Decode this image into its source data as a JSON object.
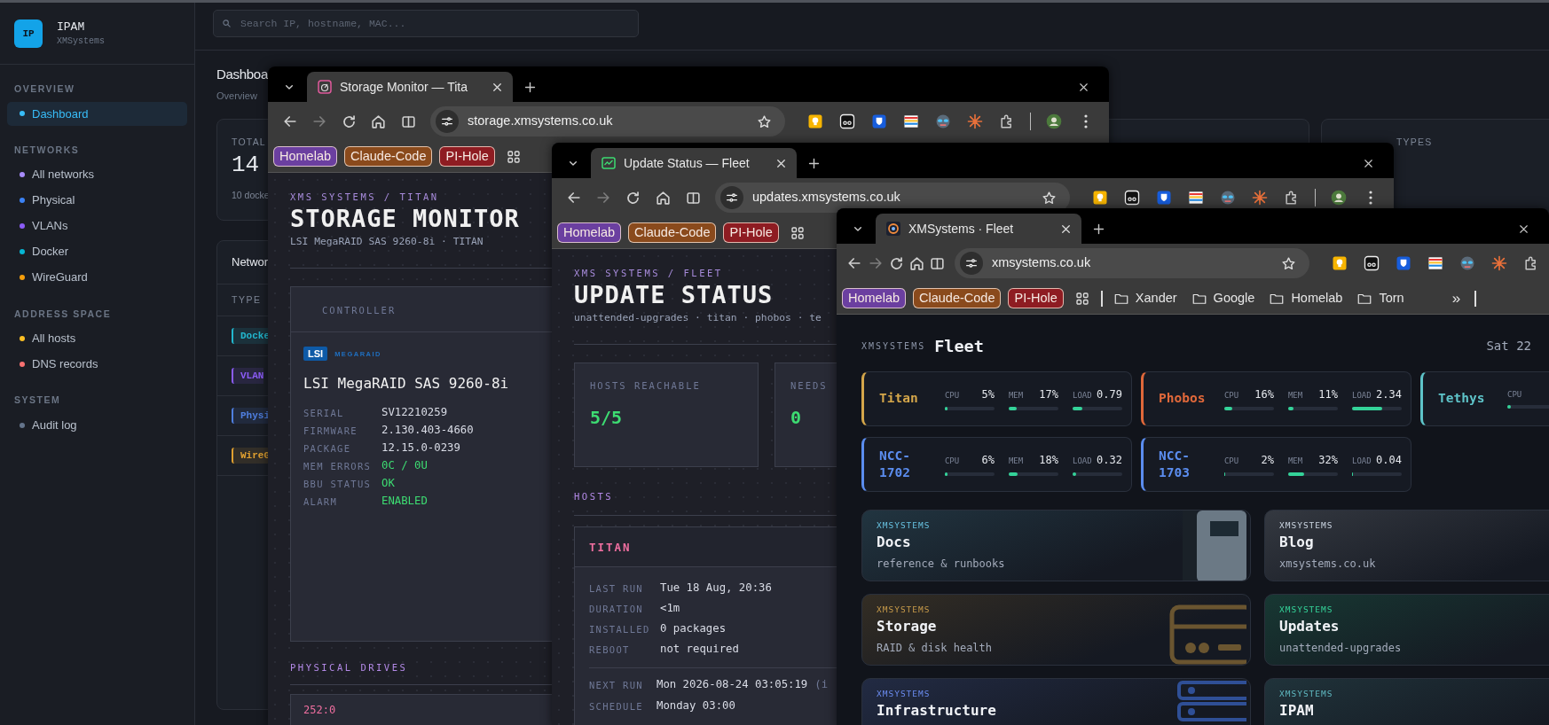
{
  "ipam": {
    "brand": {
      "logo": "IP",
      "name": "IPAM",
      "org": "XMSystems"
    },
    "search": {
      "placeholder": "Search IP, hostname, MAC..."
    },
    "sidebar": [
      {
        "heading": "OVERVIEW",
        "items": [
          {
            "label": "Dashboard",
            "color": "#38bdf8",
            "selected": true
          }
        ]
      },
      {
        "heading": "NETWORKS",
        "items": [
          {
            "label": "All networks",
            "color": "#a78bfa",
            "selected": false
          },
          {
            "label": "Physical",
            "color": "#3b82f6",
            "selected": false
          },
          {
            "label": "VLANs",
            "color": "#8b5cf6",
            "selected": false
          },
          {
            "label": "Docker",
            "color": "#06b6d4",
            "selected": false
          },
          {
            "label": "WireGuard",
            "color": "#f59e0b",
            "selected": false
          }
        ]
      },
      {
        "heading": "ADDRESS SPACE",
        "items": [
          {
            "label": "All hosts",
            "color": "#fbbf24",
            "selected": false
          },
          {
            "label": "DNS records",
            "color": "#f87171",
            "selected": false
          }
        ]
      },
      {
        "heading": "SYSTEM",
        "items": [
          {
            "label": "Audit log",
            "color": "#64748b",
            "selected": false
          }
        ]
      }
    ],
    "page": {
      "title": "Dashboa",
      "subtitle": "Overview"
    },
    "stat_cards": [
      {
        "label": "TOTAL",
        "value": "14",
        "note": "10 docke"
      },
      {
        "label": "TYPES"
      }
    ],
    "networks_card": {
      "title": "Networ",
      "column_1": "TYPE",
      "badges": [
        {
          "label": "Docke",
          "color": "#22b8cf"
        },
        {
          "label": "VLAN",
          "color": "#8b5cf6"
        },
        {
          "label": "Physi",
          "color": "#4f7fe0"
        },
        {
          "label": "WireG",
          "color": "#e0a030"
        }
      ]
    }
  },
  "windows": [
    {
      "kind": "storage",
      "tab_title": "Storage Monitor — Tita",
      "url": "storage.xmsystems.co.uk",
      "bookmarks": [
        {
          "kind": "chip",
          "label": "Homelab",
          "color": "#6b3fa0"
        },
        {
          "kind": "chip",
          "label": "Claude-Code",
          "color": "#8a4a1c"
        },
        {
          "kind": "chip",
          "label": "PI-Hole",
          "color": "#8e1c22"
        },
        {
          "kind": "apps"
        }
      ],
      "content": {
        "breadcrumb": "XMS SYSTEMS / TITAN",
        "title": "STORAGE MONITOR",
        "subtitle": "LSI MegaRAID SAS 9260-8i · TITAN",
        "controller": {
          "heading": "CONTROLLER",
          "logo_mark": "LSI",
          "logo_text": "MEGARAID",
          "model": "LSI MegaRAID SAS 9260-8i",
          "fields": [
            {
              "label": "SERIAL",
              "value": "SV12210259",
              "kind": "plain"
            },
            {
              "label": "FIRMWARE",
              "value": "2.130.403-4660",
              "kind": "plain"
            },
            {
              "label": "PACKAGE",
              "value": "12.15.0-0239",
              "kind": "plain"
            },
            {
              "label": "MEM ERRORS",
              "value": "0C / 0U",
              "kind": "ok"
            },
            {
              "label": "BBU STATUS",
              "value": "OK",
              "kind": "ok"
            },
            {
              "label": "ALARM",
              "value": "ENABLED",
              "kind": "ok"
            }
          ]
        },
        "drives_heading": "PHYSICAL DRIVES",
        "drives": [
          {
            "id": "252:0"
          }
        ]
      }
    },
    {
      "kind": "updates",
      "tab_title": "Update Status — Fleet",
      "url": "updates.xmsystems.co.uk",
      "bookmarks": [
        {
          "kind": "chip",
          "label": "Homelab",
          "color": "#6b3fa0"
        },
        {
          "kind": "chip",
          "label": "Claude-Code",
          "color": "#8a4a1c"
        },
        {
          "kind": "chip",
          "label": "PI-Hole",
          "color": "#8e1c22"
        },
        {
          "kind": "apps"
        }
      ],
      "content": {
        "breadcrumb": "XMS SYSTEMS / FLEET",
        "title": "UPDATE STATUS",
        "subtitle": "unattended-upgrades · titan · phobos · te",
        "stats": [
          {
            "label": "HOSTS REACHABLE",
            "value": "5/5"
          },
          {
            "label": "NEEDS",
            "value": "0"
          }
        ],
        "hosts_heading": "HOSTS",
        "host": {
          "name": "TITAN",
          "fields": [
            {
              "label": "LAST RUN",
              "value": "Tue 18 Aug, 20:36"
            },
            {
              "label": "DURATION",
              "value": "<1m"
            },
            {
              "label": "INSTALLED",
              "value": "0 packages"
            },
            {
              "label": "REBOOT",
              "value": "not required"
            }
          ],
          "schedule": [
            {
              "label": "NEXT RUN",
              "value": "Mon 2026-08-24 03:05:19",
              "note": "(i"
            },
            {
              "label": "SCHEDULE",
              "value": "Monday 03:00"
            }
          ]
        }
      }
    },
    {
      "kind": "fleet",
      "tab_title": "XMSystems · Fleet",
      "url": "xmsystems.co.uk",
      "bookmarks": [
        {
          "kind": "chip",
          "label": "Homelab",
          "color": "#6b3fa0"
        },
        {
          "kind": "chip",
          "label": "Claude-Code",
          "color": "#8a4a1c"
        },
        {
          "kind": "chip",
          "label": "PI-Hole",
          "color": "#8e1c22"
        },
        {
          "kind": "apps"
        },
        {
          "kind": "separator"
        },
        {
          "kind": "folder",
          "label": "Xander"
        },
        {
          "kind": "folder",
          "label": "Google"
        },
        {
          "kind": "folder",
          "label": "Homelab"
        },
        {
          "kind": "folder",
          "label": "Torn"
        },
        {
          "kind": "overflow",
          "label": "»"
        },
        {
          "kind": "separator"
        }
      ],
      "content": {
        "brand": "XMSYSTEMS",
        "title": "Fleet",
        "date": "Sat 22",
        "hosts": [
          {
            "name": "Titan",
            "color": "#d4a64a",
            "metrics": [
              {
                "label": "CPU",
                "value": "5%",
                "level": 0.05
              },
              {
                "label": "MEM",
                "value": "17%",
                "level": 0.17
              },
              {
                "label": "LOAD",
                "value": "0.79",
                "level": 0.2
              }
            ]
          },
          {
            "name": "Phobos",
            "color": "#e0683a",
            "metrics": [
              {
                "label": "CPU",
                "value": "16%",
                "level": 0.16
              },
              {
                "label": "MEM",
                "value": "11%",
                "level": 0.11
              },
              {
                "label": "LOAD",
                "value": "2.34",
                "level": 0.6
              }
            ]
          },
          {
            "name": "Tethys",
            "color": "#5ec4c9",
            "metrics": [
              {
                "label": "CPU",
                "level": 0.06
              }
            ]
          },
          {
            "name": "NCC-1702",
            "color": "#5b8def",
            "metrics": [
              {
                "label": "CPU",
                "value": "6%",
                "level": 0.06
              },
              {
                "label": "MEM",
                "value": "18%",
                "level": 0.18
              },
              {
                "label": "LOAD",
                "value": "0.32",
                "level": 0.08
              }
            ]
          },
          {
            "name": "NCC-1703",
            "color": "#5b8def",
            "metrics": [
              {
                "label": "CPU",
                "value": "2%",
                "level": 0.02
              },
              {
                "label": "MEM",
                "value": "32%",
                "level": 0.32
              },
              {
                "label": "LOAD",
                "value": "0.04",
                "level": 0.01
              }
            ]
          }
        ],
        "links": [
          {
            "kicker": "XMSYSTEMS",
            "title": "Docs",
            "subtitle": "reference & runbooks",
            "color": "#67c1e0",
            "kind": "book"
          },
          {
            "kicker": "XMSYSTEMS",
            "title": "Blog",
            "subtitle": "xmsystems.co.uk",
            "color": "#cbd5e1",
            "kind": "plain"
          },
          {
            "kicker": "XMSYSTEMS",
            "title": "Storage",
            "subtitle": "RAID & disk health",
            "color": "#c79a4a",
            "kind": "drive"
          },
          {
            "kicker": "XMSYSTEMS",
            "title": "Updates",
            "subtitle": "unattended-upgrades",
            "color": "#34d399",
            "kind": "plain"
          },
          {
            "kicker": "XMSYSTEMS",
            "title": "Infrastructure",
            "color": "#6b8cf0",
            "kind": "server"
          },
          {
            "kicker": "XMSYSTEMS",
            "title": "IPAM",
            "color": "#5fb8c0",
            "kind": "plain"
          }
        ]
      }
    }
  ]
}
